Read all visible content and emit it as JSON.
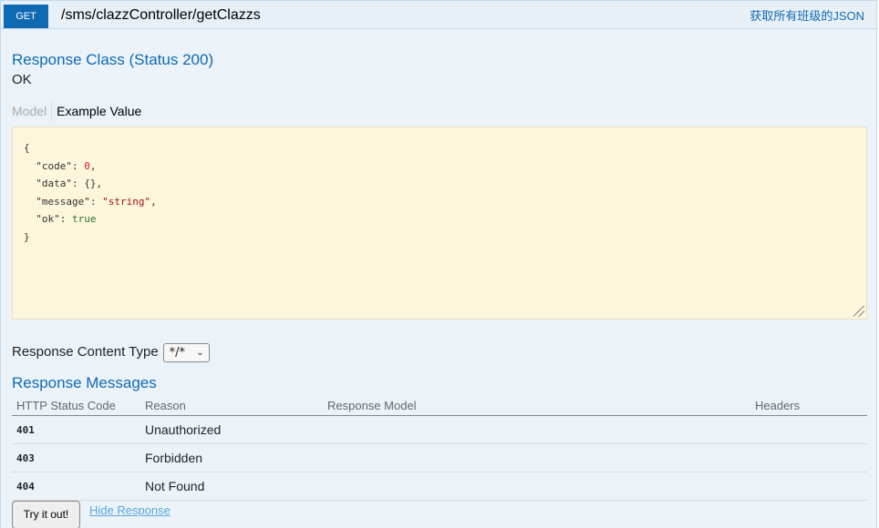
{
  "operation": {
    "method": "GET",
    "path": "/sms/clazzController/getClazzs",
    "summary": "获取所有班级的JSON"
  },
  "response_class": {
    "title": "Response Class (Status 200)",
    "status_text": "OK",
    "tabs": {
      "model": "Model",
      "example": "Example Value"
    },
    "example": {
      "open": "{",
      "lines": [
        {
          "key": "\"code\"",
          "value": "0",
          "sep": ","
        },
        {
          "key": "\"data\"",
          "value": "{}",
          "sep": ","
        },
        {
          "key": "\"message\"",
          "value": "\"string\"",
          "sep": ","
        },
        {
          "key": "\"ok\"",
          "value": "true",
          "sep": ""
        }
      ],
      "close": "}"
    }
  },
  "response_content_type": {
    "label": "Response Content Type",
    "selected": "*/*"
  },
  "response_messages": {
    "title": "Response Messages",
    "columns": [
      "HTTP Status Code",
      "Reason",
      "Response Model",
      "Headers"
    ],
    "rows": [
      {
        "code": "401",
        "reason": "Unauthorized",
        "model": "",
        "headers": ""
      },
      {
        "code": "403",
        "reason": "Forbidden",
        "model": "",
        "headers": ""
      },
      {
        "code": "404",
        "reason": "Not Found",
        "model": "",
        "headers": ""
      }
    ]
  },
  "actions": {
    "try_label": "Try it out!",
    "hide_label": "Hide Response"
  },
  "colors": {
    "method_bg": "#0f6ab4",
    "panel_bg": "#ebf3f9",
    "snippet_bg": "#fcf6db",
    "link": "#0f6ab4"
  }
}
